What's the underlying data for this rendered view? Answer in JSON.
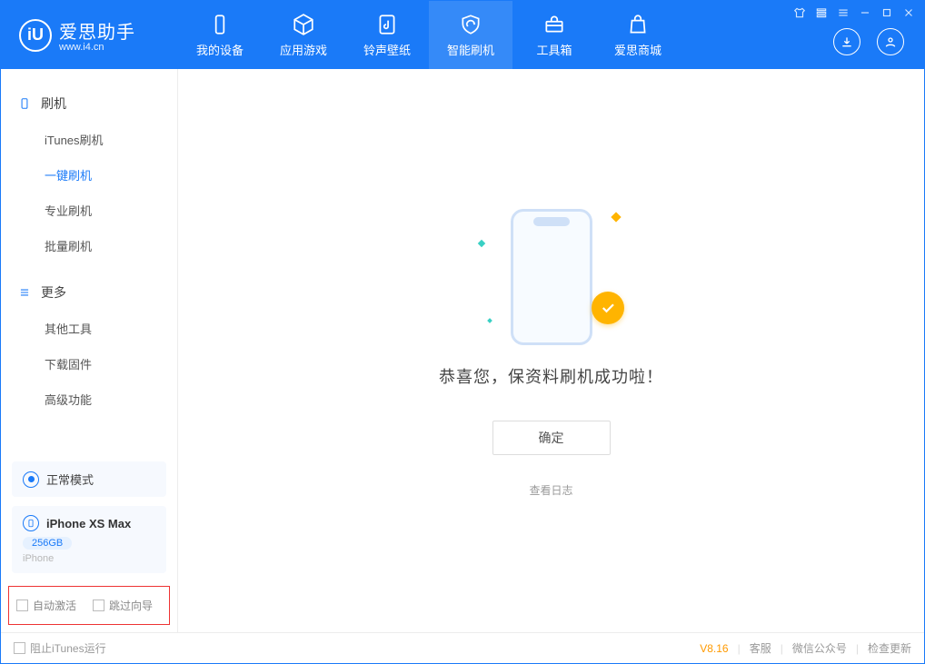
{
  "app": {
    "title": "爱思助手",
    "subtitle": "www.i4.cn"
  },
  "tabs": {
    "device": "我的设备",
    "apps": "应用游戏",
    "ring": "铃声壁纸",
    "flash": "智能刷机",
    "toolbox": "工具箱",
    "store": "爱思商城"
  },
  "sidebar": {
    "group1_title": "刷机",
    "group1": {
      "itunes": "iTunes刷机",
      "oneclick": "一键刷机",
      "pro": "专业刷机",
      "batch": "批量刷机"
    },
    "group2_title": "更多",
    "group2": {
      "other": "其他工具",
      "firmware": "下载固件",
      "advanced": "高级功能"
    },
    "mode_card": "正常模式",
    "device_name": "iPhone XS Max",
    "device_cap": "256GB",
    "device_type": "iPhone",
    "cb1": "自动激活",
    "cb2": "跳过向导"
  },
  "main": {
    "success": "恭喜您，保资料刷机成功啦！",
    "ok": "确定",
    "viewlog": "查看日志"
  },
  "footer": {
    "block_itunes": "阻止iTunes运行",
    "version": "V8.16",
    "support": "客服",
    "wechat": "微信公众号",
    "update": "检查更新"
  }
}
